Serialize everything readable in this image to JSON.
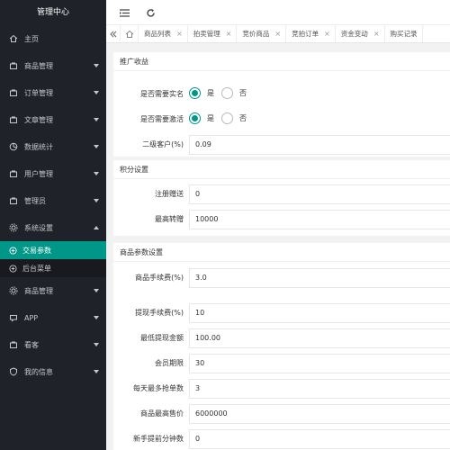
{
  "brand": "管理中心",
  "sidebar": {
    "items": [
      {
        "label": "主页",
        "icon": "home-icon"
      },
      {
        "label": "商品管理",
        "icon": "shopping-icon"
      },
      {
        "label": "订单管理",
        "icon": "order-icon"
      },
      {
        "label": "文章管理",
        "icon": "article-icon"
      },
      {
        "label": "数据统计",
        "icon": "chart-icon"
      },
      {
        "label": "用户管理",
        "icon": "user-icon"
      },
      {
        "label": "管理员",
        "icon": "admin-icon"
      },
      {
        "label": "系统设置",
        "icon": "settings-icon"
      },
      {
        "label": "商品管理",
        "icon": "shopping-icon"
      },
      {
        "label": "APP",
        "icon": "app-icon"
      },
      {
        "label": "看客",
        "icon": "viewer-icon"
      },
      {
        "label": "我的信息",
        "icon": "profile-icon"
      }
    ],
    "subitems": [
      {
        "label": "交易参数",
        "icon": "transaction-icon"
      },
      {
        "label": "后台菜单",
        "icon": "menu-icon"
      }
    ]
  },
  "tabs": [
    "商品列表",
    "拍卖管理",
    "竞价商品",
    "竞拍订单",
    "资金变动",
    "购买记录"
  ],
  "cards": {
    "promo": {
      "title": "推广收益",
      "realname_label": "是否需要实名",
      "activate_label": "是否需要激活",
      "yes": "是",
      "no": "否",
      "second_level_label": "二级客户(%)",
      "second_level_value": "0.09"
    },
    "points": {
      "title": "积分设置",
      "register_gift_label": "注册赠送",
      "register_gift_value": "0",
      "max_transfer_label": "最高转赠",
      "max_transfer_value": "10000"
    },
    "goods": {
      "title": "商品参数设置",
      "fee_label": "商品手续费(%)",
      "fee_value": "3.0",
      "withdraw_fee_label": "提现手续费(%)",
      "withdraw_fee_value": "10",
      "min_withdraw_label": "最低提现金额",
      "min_withdraw_value": "100.00",
      "member_period_label": "会员期限",
      "member_period_value": "30",
      "daily_grab_label": "每天最多抢单数",
      "daily_grab_value": "3",
      "max_price_label": "商品最高售价",
      "max_price_value": "6000000",
      "newbie_label": "新手提前分钟数",
      "newbie_value": "0"
    }
  },
  "colors": {
    "sidebar_bg": "#20222a",
    "accent": "#009688"
  }
}
